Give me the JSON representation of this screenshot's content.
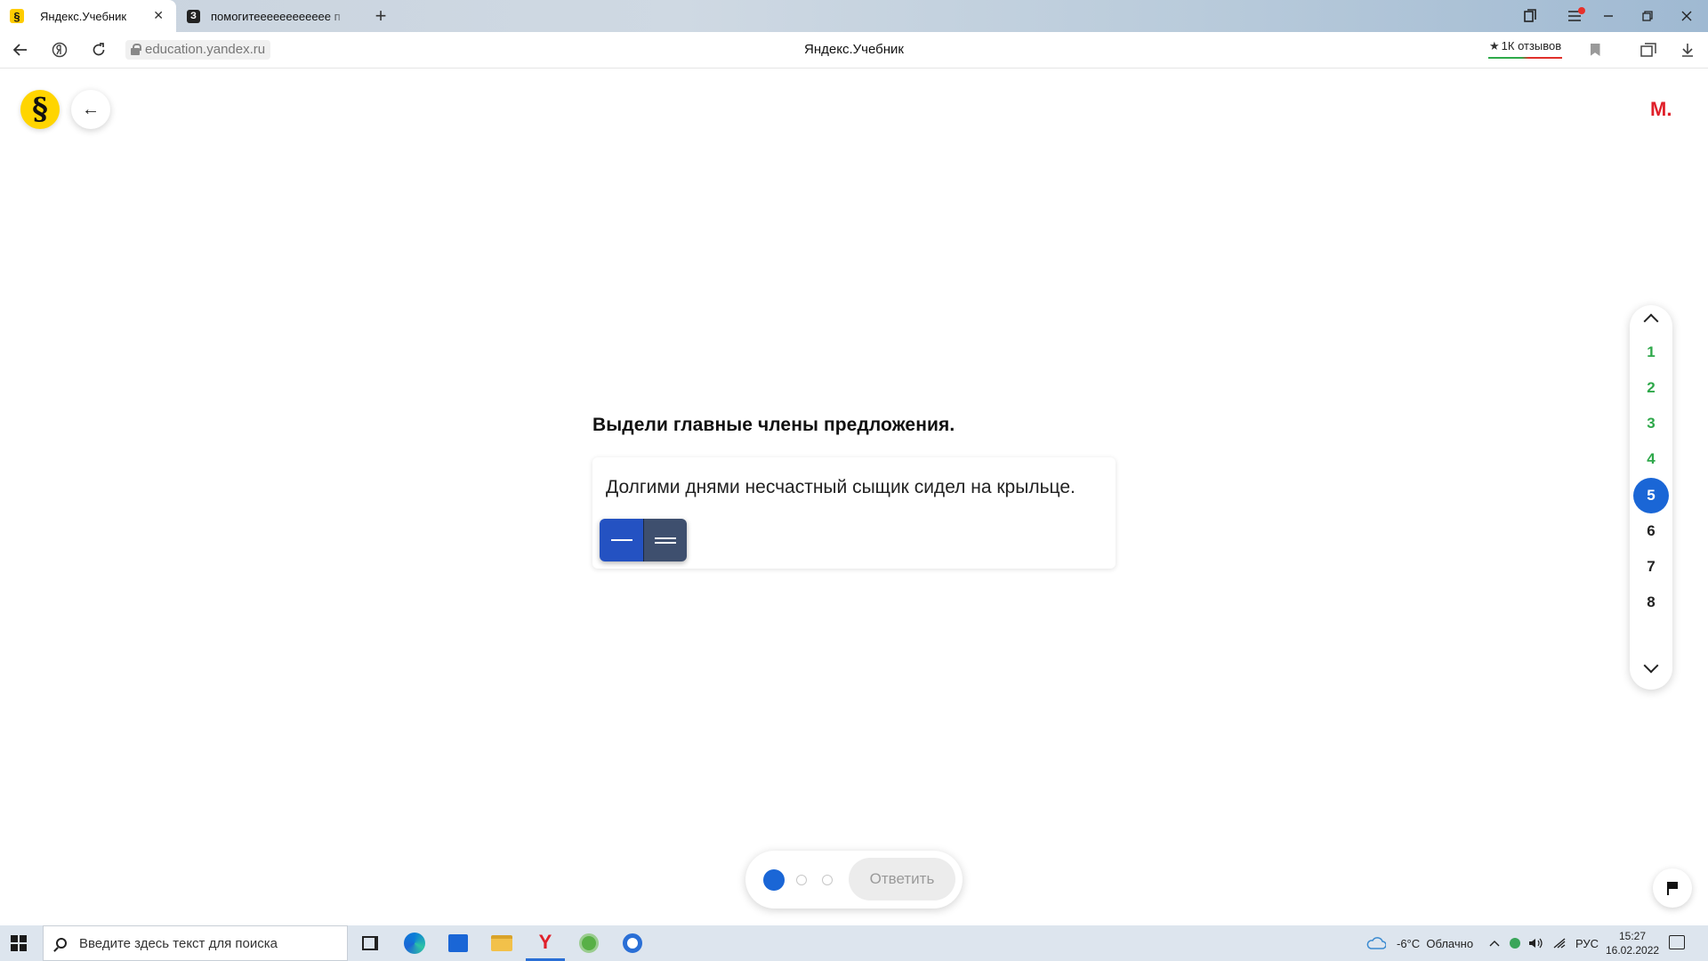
{
  "browser": {
    "tabs": [
      {
        "label": "Яндекс.Учебник",
        "favicon": "§",
        "active": true
      },
      {
        "label": "помогитееееееееееее п",
        "favicon": "З",
        "active": false
      }
    ],
    "close_tab_glyph": "✕",
    "new_tab_glyph": "+",
    "url": "education.yandex.ru",
    "page_title": "Яндекс.Учебник",
    "reviews_label": "1К отзывов",
    "reviews_star": "★"
  },
  "header": {
    "logo_glyph": "§",
    "back_glyph": "←",
    "user_initial": "М."
  },
  "task": {
    "question": "Выдели главные члены предложения.",
    "sentence": "Долгими днями несчастный сыщик сидел на крыльце.",
    "tools": [
      {
        "name": "subject",
        "active": true
      },
      {
        "name": "predicate",
        "active": false
      }
    ]
  },
  "task_nav": {
    "items": [
      {
        "label": "1",
        "state": "done"
      },
      {
        "label": "2",
        "state": "done"
      },
      {
        "label": "3",
        "state": "done"
      },
      {
        "label": "4",
        "state": "done"
      },
      {
        "label": "5",
        "state": "current"
      },
      {
        "label": "6",
        "state": "todo"
      },
      {
        "label": "7",
        "state": "todo"
      },
      {
        "label": "8",
        "state": "todo"
      }
    ]
  },
  "answer_bar": {
    "attempts_total": 3,
    "attempt_current": 1,
    "answer_label": "Ответить"
  },
  "taskbar": {
    "search_placeholder": "Введите здесь текст для поиска",
    "weather": "-6°C  Облачно",
    "language": "РУС",
    "time": "15:27",
    "date": "16.02.2022"
  },
  "colors": {
    "accent": "#1a66d6",
    "done": "#2ea84a",
    "logo_yellow": "#ffd500",
    "user_red": "#e0202a",
    "subject_tool": "#2452c2",
    "predicate_tool": "#3e4f6e"
  }
}
